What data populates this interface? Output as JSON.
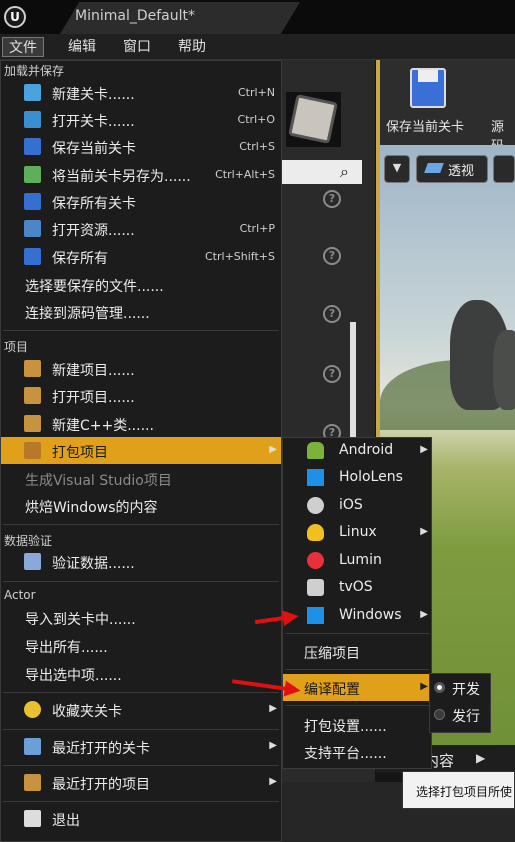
{
  "window": {
    "tab_title": "Minimal_Default*"
  },
  "menubar": [
    "文件",
    "编辑",
    "窗口",
    "帮助"
  ],
  "background": {
    "save_current_label": "保存当前关卡",
    "source_label": "源码",
    "viewport_perspective": "透视",
    "content_label": "内容",
    "tooltip": "选择打包项目所使"
  },
  "file_menu": {
    "sections": {
      "load_save": "加载并保存",
      "project": "项目",
      "data_validation": "数据验证",
      "actor": "Actor"
    },
    "items": {
      "new_level": {
        "label": "新建关卡......",
        "shortcut": "Ctrl+N"
      },
      "open_level": {
        "label": "打开关卡......",
        "shortcut": "Ctrl+O"
      },
      "save_current": {
        "label": "保存当前关卡",
        "shortcut": "Ctrl+S"
      },
      "save_current_as": {
        "label": "将当前关卡另存为......",
        "shortcut": "Ctrl+Alt+S"
      },
      "save_all_levels": {
        "label": "保存所有关卡"
      },
      "open_asset": {
        "label": "打开资源......",
        "shortcut": "Ctrl+P"
      },
      "save_all": {
        "label": "保存所有",
        "shortcut": "Ctrl+Shift+S"
      },
      "choose_files": {
        "label": "选择要保存的文件......"
      },
      "connect_source": {
        "label": "连接到源码管理......"
      },
      "new_project": {
        "label": "新建项目......"
      },
      "open_project": {
        "label": "打开项目......"
      },
      "new_cpp_class": {
        "label": "新建C++类......"
      },
      "package_project": {
        "label": "打包项目"
      },
      "generate_vs": {
        "label": "生成Visual Studio项目"
      },
      "cook_windows": {
        "label": "烘焙Windows的内容"
      },
      "validate_data": {
        "label": "验证数据......"
      },
      "import_into_level": {
        "label": "导入到关卡中......"
      },
      "export_all": {
        "label": "导出所有......"
      },
      "export_selected": {
        "label": "导出选中项......"
      },
      "favorite_levels": {
        "label": "收藏夹关卡"
      },
      "recent_levels": {
        "label": "最近打开的关卡"
      },
      "recent_projects": {
        "label": "最近打开的项目"
      },
      "exit": {
        "label": "退出"
      }
    }
  },
  "platform_menu": {
    "platforms": {
      "android": "Android",
      "hololens": "HoloLens",
      "ios": "iOS",
      "linux": "Linux",
      "lumin": "Lumin",
      "tvos": "tvOS",
      "windows": "Windows"
    },
    "zip_project": "压缩项目",
    "build_configuration": "编译配置",
    "packaging_settings": "打包设置......",
    "supported_platforms": "支持平台......"
  },
  "build_config_menu": {
    "development": "开发",
    "shipping": "发行",
    "selected": "开发"
  },
  "colors": {
    "highlight": "#e0a019",
    "menu_bg": "#1c1c1c",
    "annotation_arrow": "#e01010"
  }
}
